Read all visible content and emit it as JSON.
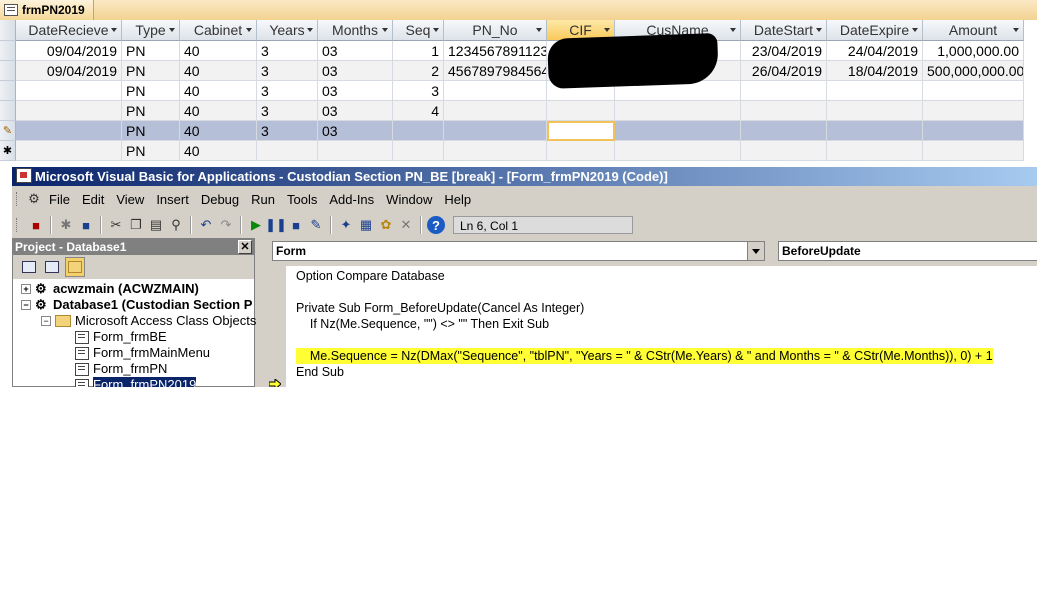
{
  "access_tab": {
    "title": "frmPN2019"
  },
  "datasheet": {
    "columns": [
      {
        "label": "DateRecieve"
      },
      {
        "label": "Type"
      },
      {
        "label": "Cabinet"
      },
      {
        "label": "Years"
      },
      {
        "label": "Months"
      },
      {
        "label": "Seq"
      },
      {
        "label": "PN_No"
      },
      {
        "label": "CIF"
      },
      {
        "label": "CusName"
      },
      {
        "label": "DateStart"
      },
      {
        "label": "DateExpire"
      },
      {
        "label": "Amount"
      }
    ],
    "rows": [
      {
        "selector": "",
        "cells": [
          "09/04/2019",
          "PN",
          "40",
          "3",
          "03",
          "1",
          "1234567891123",
          "",
          "",
          "23/04/2019",
          "24/04/2019",
          "1,000,000.00"
        ]
      },
      {
        "selector": "",
        "cells": [
          "09/04/2019",
          "PN",
          "40",
          "3",
          "03",
          "2",
          "4567897984564",
          "",
          "",
          "26/04/2019",
          "18/04/2019",
          "500,000,000.00"
        ]
      },
      {
        "selector": "",
        "cells": [
          "",
          "PN",
          "40",
          "3",
          "03",
          "3",
          "",
          "",
          "",
          "",
          "",
          ""
        ]
      },
      {
        "selector": "",
        "cells": [
          "",
          "PN",
          "40",
          "3",
          "03",
          "4",
          "",
          "",
          "",
          "",
          "",
          ""
        ]
      },
      {
        "selector": "✎",
        "cells": [
          "",
          "PN",
          "40",
          "3",
          "03",
          "",
          "",
          "",
          "",
          "",
          "",
          ""
        ]
      },
      {
        "selector": "✱",
        "cells": [
          "",
          "PN",
          "40",
          "",
          "",
          "",
          "",
          "",
          "",
          "",
          "",
          ""
        ]
      }
    ]
  },
  "vbe": {
    "title": "Microsoft Visual Basic for Applications - Custodian Section PN_BE [break] - [Form_frmPN2019 (Code)]",
    "menu": [
      "File",
      "Edit",
      "View",
      "Insert",
      "Debug",
      "Run",
      "Tools",
      "Add-Ins",
      "Window",
      "Help"
    ],
    "status_position": "Ln 6, Col 1",
    "project_title": "Project - Database1",
    "tree": [
      {
        "label": "acwzmain (ACWZMAIN)"
      },
      {
        "label": "Database1 (Custodian Section P"
      },
      {
        "label": "Microsoft Access Class Objects"
      },
      {
        "label": "Form_frmBE"
      },
      {
        "label": "Form_frmMainMenu"
      },
      {
        "label": "Form_frmPN"
      },
      {
        "label": "Form_frmPN2019"
      }
    ],
    "object_combo": "Form",
    "procedure_combo": "BeforeUpdate",
    "code_lines": [
      "Option Compare Database",
      "",
      "Private Sub Form_BeforeUpdate(Cancel As Integer)",
      "    If Nz(Me.Sequence, \"\") <> \"\" Then Exit Sub",
      "",
      "    Me.Sequence = Nz(DMax(\"Sequence\", \"tblPN\", \"Years = \" & CStr(Me.Years) & \" and Months = \" & CStr(Me.Months)), 0) + 1",
      "End Sub"
    ]
  },
  "colors": {
    "highlight": "#ffff33",
    "title_gradient_start": "#0a246a",
    "selected_header": "#f9c95a"
  }
}
